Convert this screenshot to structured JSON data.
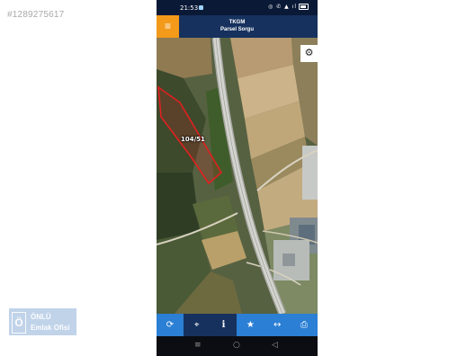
{
  "listing": {
    "id_text": "#1289275617"
  },
  "status_bar": {
    "time": "21:53",
    "icons": "◎ ✆ ▲ ıl"
  },
  "header": {
    "menu_icon": "≡",
    "title": "TKGM",
    "subtitle": "Parsel Sorgu"
  },
  "map": {
    "parcel_label": "104/51",
    "settings_icon": "⚙",
    "parcel_color": "#e02020"
  },
  "toolbar": {
    "items": [
      {
        "name": "refresh-icon",
        "glyph": "⟳"
      },
      {
        "name": "locate-icon",
        "glyph": "⌖"
      },
      {
        "name": "info-icon",
        "glyph": "i"
      },
      {
        "name": "star-icon",
        "glyph": "★"
      },
      {
        "name": "measure-icon",
        "glyph": "↔"
      },
      {
        "name": "print-icon",
        "glyph": "⎙"
      }
    ],
    "active_index": 1
  },
  "nav_bar": {
    "menu": "≡",
    "home": "○",
    "back": "◁"
  },
  "watermark": {
    "logo_letter": "Ö",
    "line1": "ÖNLÜ",
    "line2": "Emlak Ofisi"
  }
}
